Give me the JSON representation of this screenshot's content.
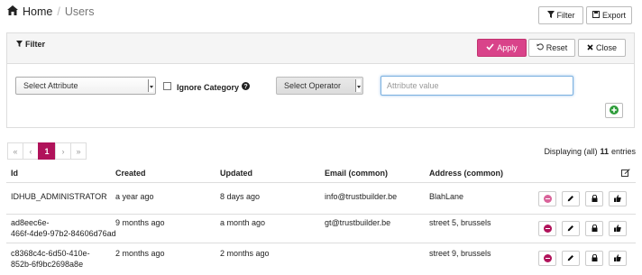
{
  "breadcrumb": {
    "home": "Home",
    "current": "Users"
  },
  "toolbar": {
    "filter_label": "Filter",
    "export_label": "Export"
  },
  "filter_panel": {
    "title": "Filter",
    "apply_label": "Apply",
    "reset_label": "Reset",
    "close_label": "Close",
    "attribute_select": "Select Attribute",
    "ignore_category_label": "Ignore Category",
    "operator_select": "Select Operator",
    "value_placeholder": "Attribute value"
  },
  "pagination": {
    "first": "«",
    "prev": "‹",
    "current": "1",
    "next": "›",
    "last": "»"
  },
  "summary": {
    "prefix": "Displaying (all)",
    "count": "11",
    "suffix": "entries"
  },
  "table": {
    "headers": [
      "Id",
      "Created",
      "Updated",
      "Email (common)",
      "Address (common)"
    ],
    "rows": [
      {
        "id_line1": "IDHUB_ADMINISTRATOR",
        "id_line2": "",
        "created": "a year ago",
        "updated": "8 days ago",
        "email": "info@trustbuilder.be",
        "address": "BlahLane"
      },
      {
        "id_line1": "ad8eec6e-",
        "id_line2": "466f-4de9-97b2-84606d76ad",
        "created": "9 months ago",
        "updated": "a month ago",
        "email": "gt@trustbuilder.be",
        "address": "street 5, brussels"
      },
      {
        "id_line1": "c8368c4c-6d50-410e-",
        "id_line2": "852b-6f9bc2698a8e",
        "created": "2 months ago",
        "updated": "2 months ago",
        "email": "",
        "address": "street 9, brussels"
      }
    ]
  },
  "colors": {
    "accent": "#b0125a",
    "apply_bg": "#d9438a",
    "add_green": "#2e9c3a"
  },
  "icons": [
    "home-icon",
    "filter-icon",
    "save-icon",
    "check-icon",
    "undo-icon",
    "close-icon",
    "help-icon",
    "plus-circle-icon",
    "edit-column-icon",
    "minus-circle-icon",
    "pencil-icon",
    "lock-icon",
    "thumbs-up-icon"
  ]
}
